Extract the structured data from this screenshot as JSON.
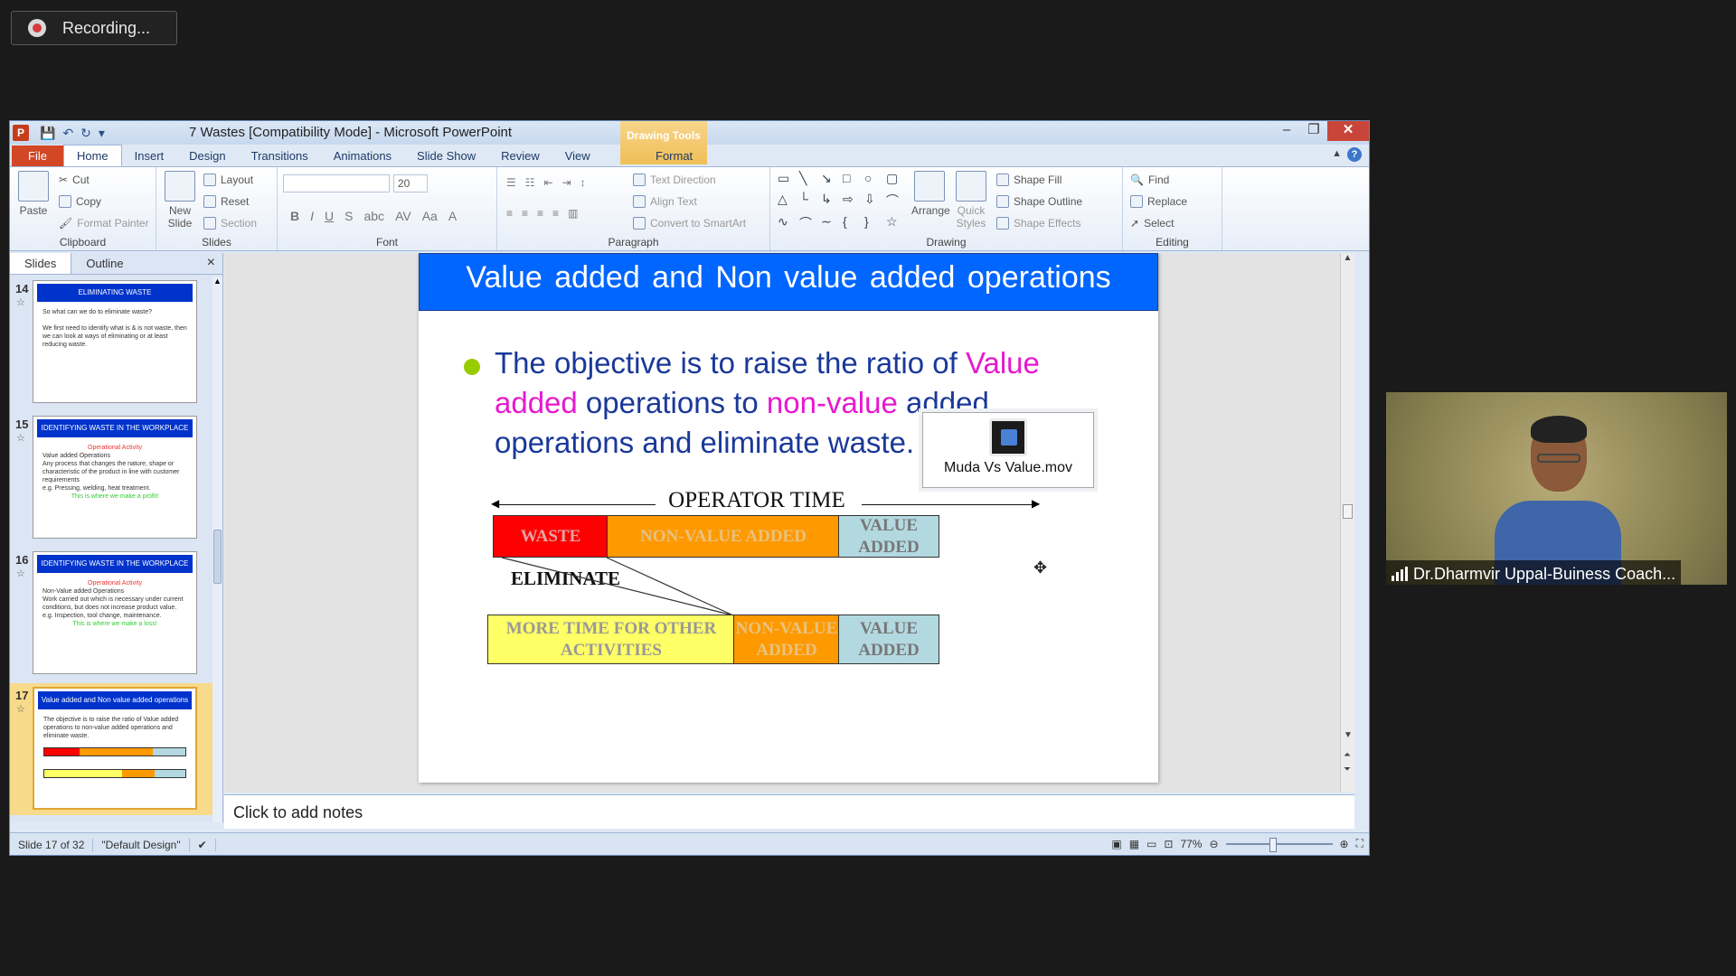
{
  "recording": {
    "label": "Recording..."
  },
  "window": {
    "title": "7 Wastes [Compatibility Mode]  -  Microsoft PowerPoint",
    "contextual_tab_group": "Drawing Tools"
  },
  "tabs": [
    "File",
    "Home",
    "Insert",
    "Design",
    "Transitions",
    "Animations",
    "Slide Show",
    "Review",
    "View",
    "Format"
  ],
  "ribbon": {
    "clipboard": {
      "paste": "Paste",
      "cut": "Cut",
      "copy": "Copy",
      "format_painter": "Format Painter",
      "label": "Clipboard"
    },
    "slides": {
      "new_slide": "New Slide",
      "layout": "Layout",
      "reset": "Reset",
      "section": "Section",
      "label": "Slides"
    },
    "font": {
      "size": "20",
      "label": "Font"
    },
    "paragraph": {
      "text_direction": "Text Direction",
      "align_text": "Align Text",
      "convert_smartart": "Convert to SmartArt",
      "label": "Paragraph"
    },
    "drawing": {
      "arrange": "Arrange",
      "quick_styles": "Quick Styles",
      "shape_fill": "Shape Fill",
      "shape_outline": "Shape Outline",
      "shape_effects": "Shape Effects",
      "label": "Drawing"
    },
    "editing": {
      "find": "Find",
      "replace": "Replace",
      "select": "Select",
      "label": "Editing"
    }
  },
  "left_pane": {
    "tabs": [
      "Slides",
      "Outline"
    ],
    "thumbnails": [
      {
        "num": "14",
        "title": "ELIMINATING WASTE",
        "lines": [
          "So what can we do to eliminate waste?",
          "We first need to identify what is & is not waste, then we can look at ways of eliminating or at least reducing waste."
        ]
      },
      {
        "num": "15",
        "title": "IDENTIFYING WASTE IN THE WORKPLACE",
        "lines": [
          "Operational Activity",
          "Value added Operations",
          "Any process that changes the nature, shape or characteristic of the product in line with customer requirements",
          "e.g. Pressing, welding, heat treatment.",
          "This is where we make a profit!"
        ]
      },
      {
        "num": "16",
        "title": "IDENTIFYING WASTE IN THE WORKPLACE",
        "lines": [
          "Operational Activity",
          "Non-Value added Operations",
          "Work carried out which is necessary under current conditions, but does not increase product value.",
          "e.g. Inspection, tool change, maintenance.",
          "This is where we make a loss!"
        ]
      },
      {
        "num": "17",
        "title": "Value added and Non value added operations",
        "lines": [
          "The objective is to raise the ratio of Value added operations to non-value added operations and eliminate waste."
        ]
      }
    ]
  },
  "slide": {
    "title": "Value added and Non value added operations",
    "bullet_parts": [
      "The objective is to raise the ratio of ",
      "Value added",
      " operations to ",
      "non-value",
      " added operations and eliminate waste."
    ],
    "operator_time": "OPERATOR TIME",
    "top_row": [
      "WASTE",
      "NON-VALUE ADDED",
      "VALUE ADDED"
    ],
    "eliminate": "ELIMINATE",
    "bottom_row": [
      "MORE TIME FOR OTHER ACTIVITIES",
      "NON-VALUE ADDED",
      "VALUE ADDED"
    ],
    "media_label": "Muda Vs Value.mov"
  },
  "notes": {
    "placeholder": "Click to add notes"
  },
  "status": {
    "slide": "Slide 17 of 32",
    "theme": "\"Default Design\"",
    "zoom": "77%"
  },
  "webcam": {
    "name": "Dr.Dharmvir Uppal-Buiness Coach..."
  },
  "colors": {
    "slide_title_bg": "#0066ff",
    "bullet_text": "#1a3899",
    "highlight": "#e619cf",
    "waste": "#ff0000",
    "non_value": "#ff9900",
    "value": "#b3d9e0",
    "more_time": "#ffff66"
  }
}
